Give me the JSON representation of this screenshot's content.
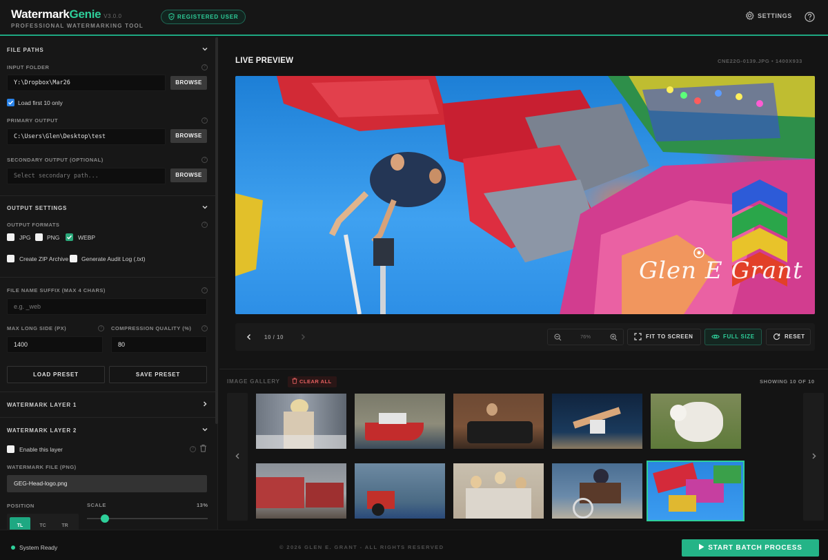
{
  "header": {
    "app_name_a": "Watermark",
    "app_name_b": "Genie",
    "version": "V3.0.0",
    "subtitle": "PROFESSIONAL WATERMARKING TOOL",
    "badge": "REGISTERED USER",
    "settings_label": "SETTINGS",
    "help_icon": "help-circle-icon",
    "accent": "#2ecf9a"
  },
  "sidebar": {
    "file_paths": {
      "title": "FILE PATHS",
      "input_folder_label": "INPUT FOLDER",
      "input_folder_value": "Y:\\Dropbox\\Mar26",
      "load_first_label": "Load first 10 only",
      "load_first_checked": true,
      "primary_output_label": "PRIMARY OUTPUT",
      "primary_output_value": "C:\\Users\\Glen\\Desktop\\test",
      "secondary_output_label": "SECONDARY OUTPUT (OPTIONAL)",
      "secondary_output_placeholder": "Select secondary path...",
      "browse_label": "BROWSE"
    },
    "output_settings": {
      "title": "OUTPUT SETTINGS",
      "formats_label": "OUTPUT FORMATS",
      "format_jpg": "JPG",
      "format_png": "PNG",
      "format_webp": "WEBP",
      "zip_label": "Create ZIP Archive",
      "audit_label": "Generate Audit Log (.txt)",
      "suffix_label": "FILE NAME SUFFIX (MAX 4 CHARS)",
      "suffix_placeholder": "e.g. _web",
      "max_side_label": "MAX LONG SIDE (PX)",
      "max_side_value": "1400",
      "quality_label": "COMPRESSION QUALITY (%)",
      "quality_value": "80",
      "load_preset": "LOAD PRESET",
      "save_preset": "SAVE PRESET"
    },
    "layer1": {
      "title": "WATERMARK LAYER 1"
    },
    "layer2": {
      "title": "WATERMARK LAYER 2",
      "enable_label": "Enable this layer",
      "file_label": "WATERMARK FILE (PNG)",
      "file_value": "GEG-Head-logo.png",
      "position_label": "POSITION",
      "scale_label": "SCALE",
      "scale_value": "13%",
      "pos_tl": "TL",
      "pos_tc": "TC",
      "pos_tr": "TR"
    }
  },
  "preview": {
    "title": "LIVE PREVIEW",
    "file_info": "CNE22G-0139.JPG • 1400X933",
    "watermark_text": "Glen E Grant",
    "counter": "10 / 10",
    "zoom": "76%",
    "fit_label": "FIT TO SCREEN",
    "full_label": "FULL SIZE",
    "reset_label": "RESET"
  },
  "gallery": {
    "title": "IMAGE GALLERY",
    "clear_label": "CLEAR ALL",
    "showing": "SHOWING 10 OF 10",
    "selected_index": 9,
    "thumbs": [
      "blonde-portrait",
      "red-boat",
      "leather-sofa",
      "gymnast-dancer",
      "white-dog",
      "red-houses",
      "red-tractor",
      "family-photo",
      "wheelchair-athlete",
      "carnival-ride"
    ]
  },
  "footer": {
    "status": "System Ready",
    "copyright": "© 2026 GLEN E. GRANT - ALL RIGHTS RESERVED",
    "start_label": "START BATCH PROCESS"
  }
}
